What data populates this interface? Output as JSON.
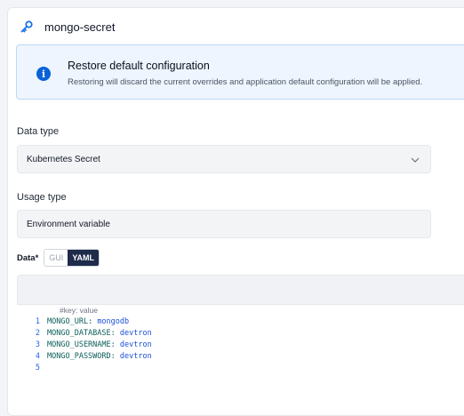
{
  "header": {
    "title": "mongo-secret",
    "icon": "key-icon"
  },
  "info": {
    "title": "Restore default configuration",
    "description": "Restoring will discard the current overrides and application default configuration will be applied."
  },
  "data_type": {
    "label": "Data type",
    "value": "Kubernetes Secret"
  },
  "usage_type": {
    "label": "Usage type",
    "value": "Environment variable"
  },
  "data": {
    "label": "Data*",
    "tabs": [
      "GUI",
      "YAML"
    ],
    "active_tab": "YAML"
  },
  "editor": {
    "placeholder_comment": "#key: value",
    "lines": [
      {
        "num": "1",
        "key": "MONGO_URL",
        "value": "mongodb"
      },
      {
        "num": "2",
        "key": "MONGO_DATABASE",
        "value": "devtron"
      },
      {
        "num": "3",
        "key": "MONGO_USERNAME",
        "value": "devtron"
      },
      {
        "num": "4",
        "key": "MONGO_PASSWORD",
        "value": "devtron"
      },
      {
        "num": "5",
        "key": "",
        "value": ""
      }
    ]
  },
  "colors": {
    "accent": "#0a62d6",
    "tab_active": "#1e2b4a",
    "info_bg": "#eef5ff"
  }
}
